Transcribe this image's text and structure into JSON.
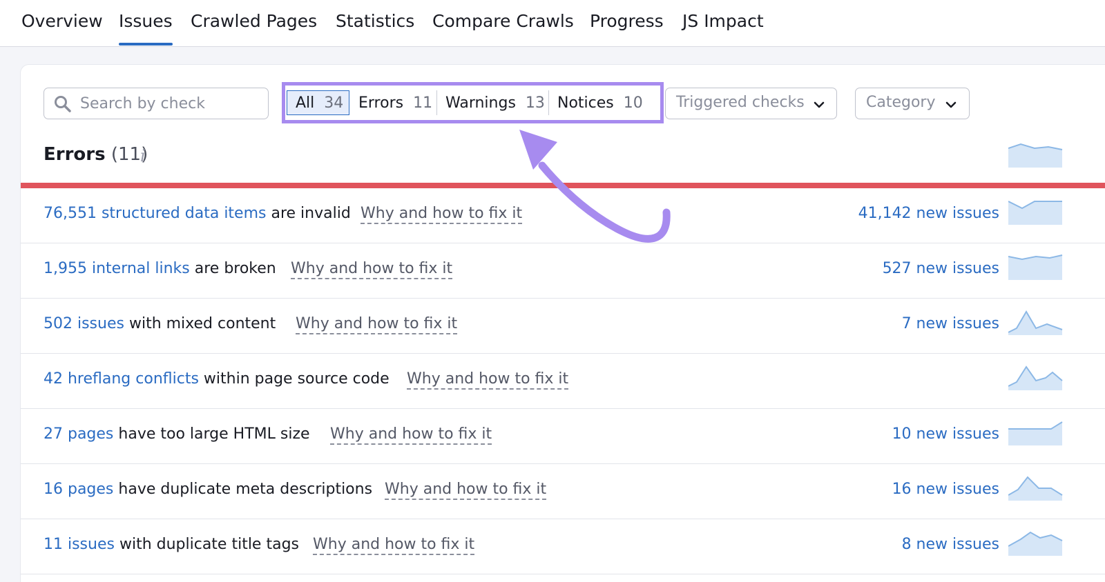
{
  "nav": {
    "tabs": [
      {
        "label": "Overview"
      },
      {
        "label": "Issues"
      },
      {
        "label": "Crawled Pages"
      },
      {
        "label": "Statistics"
      },
      {
        "label": "Compare Crawls"
      },
      {
        "label": "Progress"
      },
      {
        "label": "JS Impact"
      }
    ],
    "active": "Issues"
  },
  "search": {
    "placeholder": "Search by check"
  },
  "filter": {
    "segments": [
      {
        "label": "All",
        "count": "34"
      },
      {
        "label": "Errors",
        "count": "11"
      },
      {
        "label": "Warnings",
        "count": "13"
      },
      {
        "label": "Notices",
        "count": "10"
      }
    ]
  },
  "dropdowns": {
    "triggered": "Triggered checks",
    "category": "Category"
  },
  "section": {
    "title": "Errors",
    "count": "(11)",
    "info": "i"
  },
  "issues": [
    {
      "link": "76,551 structured data items",
      "rest": " are invalid",
      "fix": "Why and how to fix it",
      "new": "41,142 new issues"
    },
    {
      "link": "1,955 internal links",
      "rest": " are broken",
      "fix": "Why and how to fix it",
      "new": "527 new issues"
    },
    {
      "link": "502 issues",
      "rest": " with mixed content",
      "fix": "Why and how to fix it",
      "new": "7 new issues"
    },
    {
      "link": "42 hreflang conflicts",
      "rest": " within page source code",
      "fix": "Why and how to fix it",
      "new": ""
    },
    {
      "link": "27 pages",
      "rest": " have too large HTML size",
      "fix": "Why and how to fix it",
      "new": "10 new issues"
    },
    {
      "link": "16 pages",
      "rest": " have duplicate meta descriptions",
      "fix": "Why and how to fix it",
      "new": "16 new issues"
    },
    {
      "link": "11 issues",
      "rest": " with duplicate title tags",
      "fix": "Why and how to fix it",
      "new": "8 new issues"
    }
  ],
  "colors": {
    "accent": "#2a6bc2",
    "highlight": "#a78bef",
    "error_bar": "#e0545c",
    "spark_fill": "#d6e6f7",
    "spark_line": "#8cb8e6"
  }
}
